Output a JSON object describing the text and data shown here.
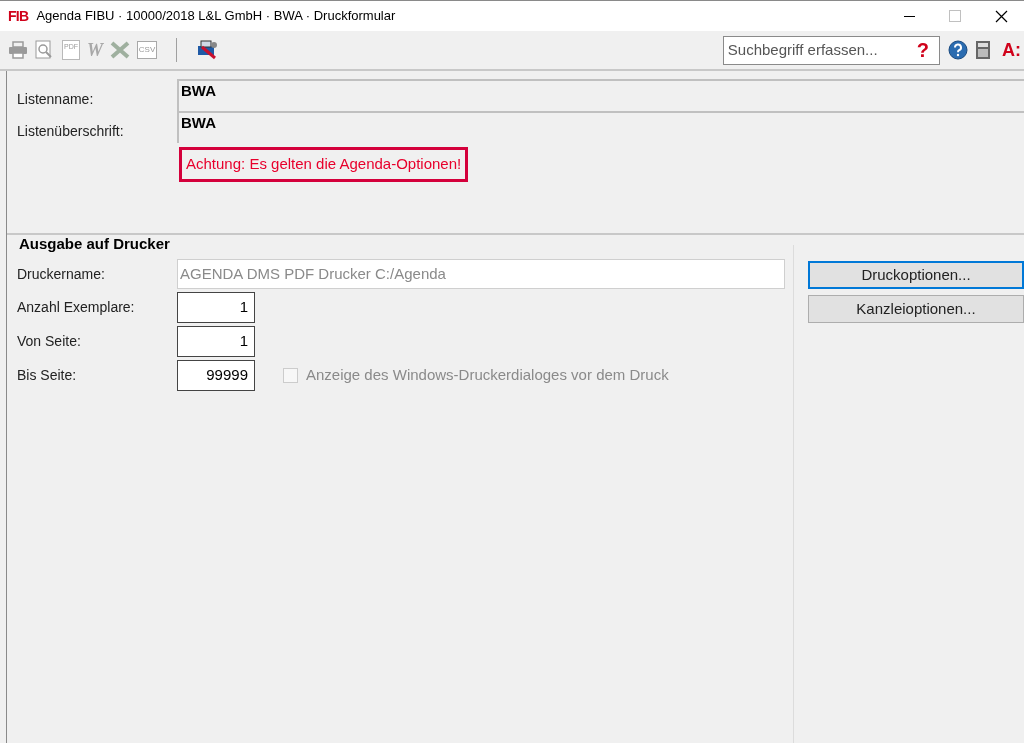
{
  "window": {
    "logo": "FIB",
    "title": "Agenda FIBU · 10000/2018 L&L GmbH · BWA · Druckformular"
  },
  "toolbar": {
    "icons": [
      {
        "kind": "printer",
        "disabled": true
      },
      {
        "kind": "preview",
        "disabled": true
      },
      {
        "kind": "pdf",
        "label": "PDF",
        "disabled": true
      },
      {
        "kind": "word",
        "label": "W",
        "disabled": true
      },
      {
        "kind": "excel",
        "disabled": true
      },
      {
        "kind": "csv",
        "label": "CSV",
        "disabled": true
      },
      {
        "kind": "separator"
      },
      {
        "kind": "printer-tools",
        "disabled": false
      }
    ],
    "search": {
      "placeholder": "Suchbegriff erfassen...",
      "help_mark": "?"
    },
    "right_mark": "A:"
  },
  "list": {
    "fields": [
      {
        "label": "Listenname:",
        "value": "BWA"
      },
      {
        "label": "Listenüberschrift:",
        "value": "BWA"
      }
    ],
    "warning": "Achtung: Es gelten die Agenda-Optionen!"
  },
  "printer_group": {
    "title": "Ausgabe auf Drucker",
    "printer_label": "Druckername:",
    "printer_value": "AGENDA DMS PDF Drucker C:/Agenda",
    "numbers": [
      {
        "label": "Anzahl Exemplare:",
        "value": "1"
      },
      {
        "label": "Von Seite:",
        "value": "1"
      },
      {
        "label": "Bis Seite:",
        "value": "99999"
      }
    ],
    "dialog_option": {
      "label": "Anzeige des Windows-Druckerdialoges vor dem Druck",
      "checked": false,
      "disabled": true
    }
  },
  "buttons": [
    {
      "label": "Druckoptionen...",
      "selected": true
    },
    {
      "label": "Kanzleioptionen...",
      "selected": false
    }
  ]
}
